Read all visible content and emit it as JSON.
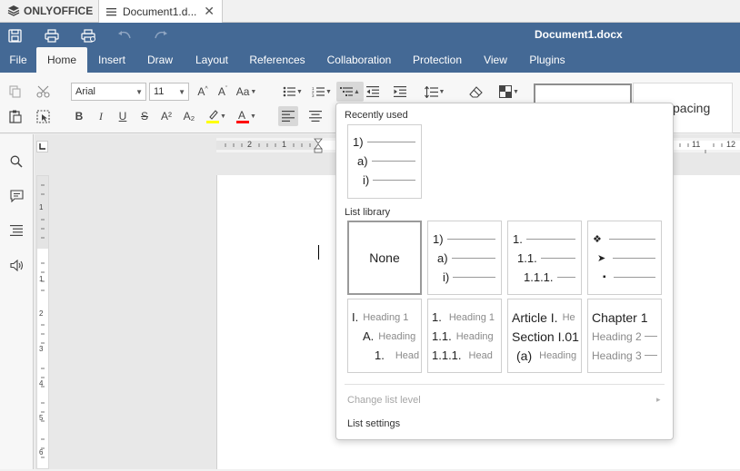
{
  "app": {
    "logo_text": "ONLYOFFICE"
  },
  "document_tab": {
    "title": "Document1.d...",
    "close": "✕"
  },
  "header": {
    "doc_title": "Document1.docx"
  },
  "menu_tabs": [
    "File",
    "Home",
    "Insert",
    "Draw",
    "Layout",
    "References",
    "Collaboration",
    "Protection",
    "View",
    "Plugins"
  ],
  "active_tab": "Home",
  "toolbar": {
    "font_name": "Arial",
    "font_size": "11",
    "style_preview_label": "pacing",
    "buttons": {
      "bold": "B",
      "italic": "I",
      "underline": "U",
      "strikethrough": "S",
      "superscript": "A²",
      "subscript": "A₂",
      "increase_font": "A^",
      "decrease_font": "A˅",
      "change_case": "Aa"
    }
  },
  "ruler": {
    "horizontal_ticks": [
      "2",
      "1",
      "11",
      "12"
    ],
    "vertical_ticks": [
      "1",
      "1",
      "2",
      "3",
      "4",
      "5",
      "6"
    ]
  },
  "multilevel_dropdown": {
    "recently_used_label": "Recently used",
    "recently_used": [
      {
        "rows": [
          "1)",
          "a)",
          "i)"
        ]
      }
    ],
    "library_label": "List library",
    "library": [
      {
        "type": "none",
        "label": "None"
      },
      {
        "type": "simple",
        "rows": [
          "1)",
          "a)",
          "i)"
        ]
      },
      {
        "type": "simple",
        "rows": [
          "1.",
          "1.1.",
          "1.1.1."
        ]
      },
      {
        "type": "bullets",
        "rows": [
          "❖",
          "➤",
          "▪"
        ]
      },
      {
        "type": "heading",
        "rows": [
          {
            "num": "I.",
            "text": "Heading 1"
          },
          {
            "num": "A.",
            "text": "Heading"
          },
          {
            "num": "1.",
            "text": "Head"
          }
        ]
      },
      {
        "type": "heading",
        "rows": [
          {
            "num": "1.",
            "text": "Heading 1"
          },
          {
            "num": "1.1.",
            "text": "Heading"
          },
          {
            "num": "1.1.1.",
            "text": "Head"
          }
        ]
      },
      {
        "type": "heading",
        "rows": [
          {
            "num": "Article I.",
            "text": "He"
          },
          {
            "num": "Section I.01",
            "text": ""
          },
          {
            "num": "(a)",
            "text": "Heading"
          }
        ]
      },
      {
        "type": "heading",
        "rows": [
          {
            "num": "Chapter 1",
            "text": ""
          },
          {
            "num": "",
            "text": "Heading 2"
          },
          {
            "num": "",
            "text": "Heading 3"
          }
        ]
      }
    ],
    "change_level_label": "Change list level",
    "list_settings_label": "List settings"
  },
  "colors": {
    "header_blue": "#446995",
    "highlight_yellow": "#ffff00",
    "font_color_red": "#ff0000"
  }
}
